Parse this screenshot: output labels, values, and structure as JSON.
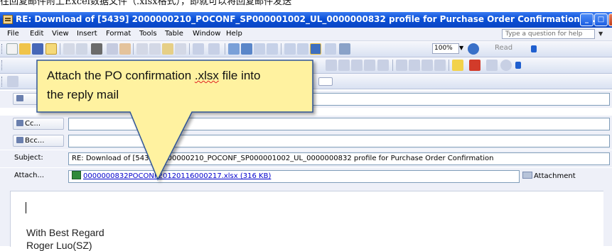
{
  "top_strip": {
    "text": "往回复邮件附上Excel数据文件（.xlsx格式），即就可以将回复邮件发送"
  },
  "window": {
    "title": "RE: Download of [5439] 2000000210_POCONF_SP000001002_UL_0000000832 profile for Purchase Order Confirmation - ..."
  },
  "menu": {
    "items": [
      "File",
      "Edit",
      "View",
      "Insert",
      "Format",
      "Tools",
      "Table",
      "Window",
      "Help"
    ],
    "help_placeholder": "Type a question for help"
  },
  "toolbar": {
    "zoom": "100%",
    "read_label": "Read"
  },
  "fields": {
    "cc_label": "Cc...",
    "bcc_label": "Bcc...",
    "subject_label": "Subject:",
    "subject_value": "RE: Download of [5439] 2000000210_POCONF_SP000001002_UL_0000000832 profile for Purchase Order Confirmation",
    "attach_label": "Attach...",
    "attachment_name": "0000000832POCONF20120116000217.xlsx (316 KB)",
    "attachment_options": "Attachment Options..."
  },
  "body": {
    "line1": "With Best Regard",
    "line2": "Roger Luo(SZ)"
  },
  "callout": {
    "line1_pre": "Attach the PO confirmation ",
    "line1_mark": ".xlsx",
    "line1_post": " file into",
    "line2": "the reply mail"
  },
  "colors": {
    "title_bar": "#0a4fd6",
    "callout_fill": "#fff2a0",
    "callout_border": "#2f5597",
    "link": "#0000cc"
  },
  "icons": [
    "app-icon",
    "minimize-icon",
    "maximize-icon",
    "close-icon",
    "excel-file-icon",
    "attachment-options-icon",
    "address-book-icon"
  ]
}
